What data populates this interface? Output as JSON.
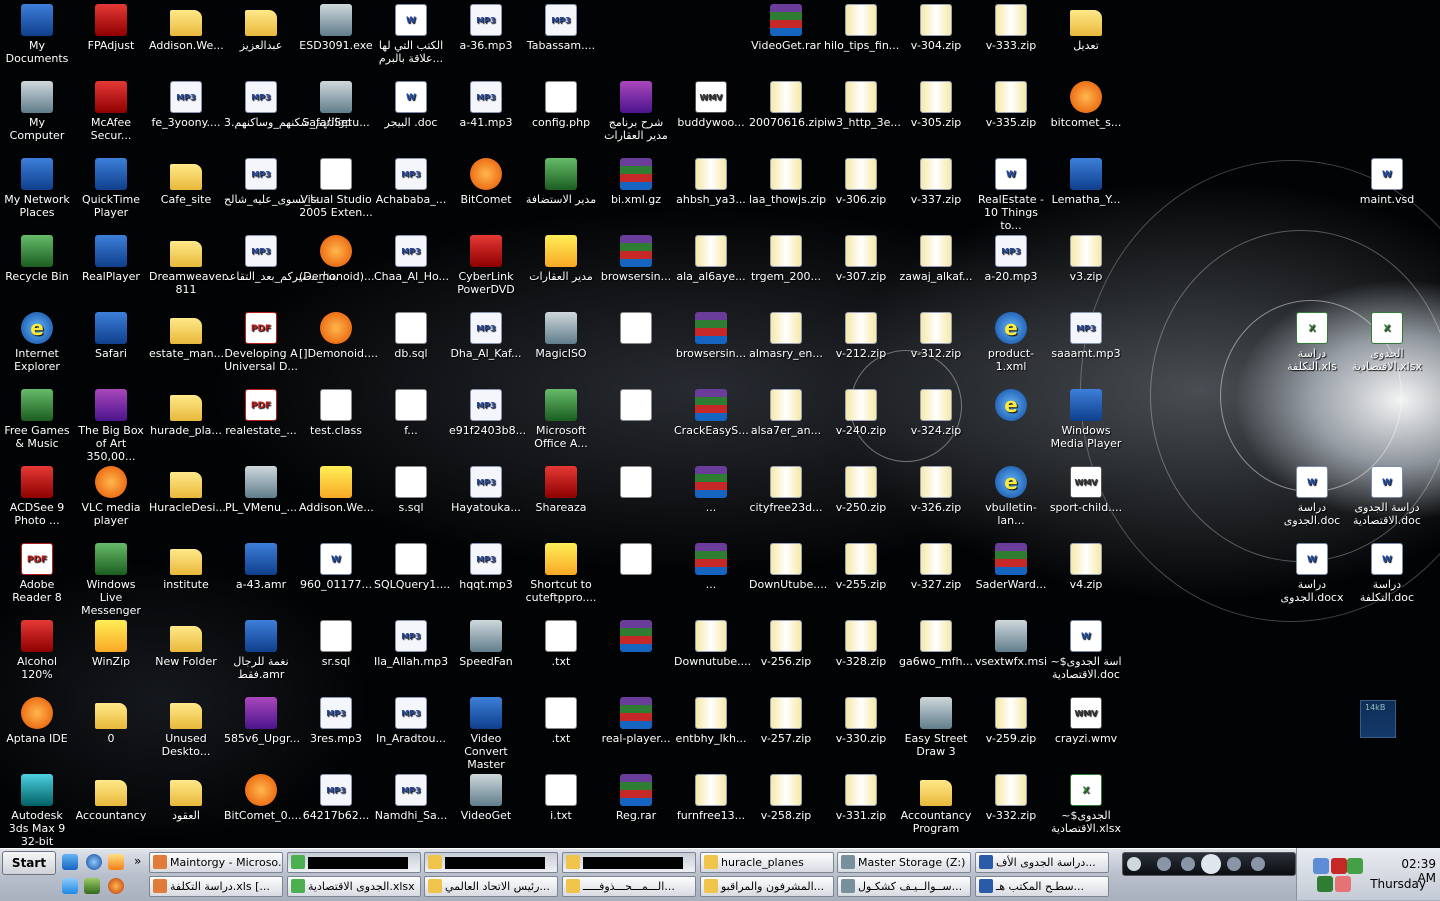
{
  "desktop_icons": [
    {
      "label": "My Documents",
      "kind": "app"
    },
    {
      "label": "FPAdjust",
      "kind": "red"
    },
    {
      "label": "Addison.We...",
      "kind": "folder"
    },
    {
      "label": "عبدالعزيز",
      "kind": "folder"
    },
    {
      "label": "ESD3091.exe",
      "kind": "sys"
    },
    {
      "label": "الكتب التي لها علاقة بالبرم...",
      "kind": "doc"
    },
    {
      "label": "a-36.mp3",
      "kind": "mp3"
    },
    {
      "label": "Tabassam....",
      "kind": "mp3"
    },
    {
      "label": "VideoGet.rar",
      "kind": "rar"
    },
    {
      "label": "hilo_tips_fin...",
      "kind": "zip"
    },
    {
      "label": "v-304.zip",
      "kind": "zip"
    },
    {
      "label": "v-333.zip",
      "kind": "zip"
    },
    {
      "label": "تعديل",
      "kind": "folder"
    },
    {
      "label": "My Computer",
      "kind": "sys"
    },
    {
      "label": "McAfee Secur...",
      "kind": "red"
    },
    {
      "label": "fe_3yoony....",
      "kind": "mp3"
    },
    {
      "label": "اللهم_سكنهم_وساكنهم.3gp",
      "kind": "mp3"
    },
    {
      "label": "SafariSetu...",
      "kind": "sys"
    },
    {
      "label": "البيجر .doc",
      "kind": "doc"
    },
    {
      "label": "a-41.mp3",
      "kind": "mp3"
    },
    {
      "label": "config.php",
      "kind": "txt"
    },
    {
      "label": "شرح برنامج مدير العقارات",
      "kind": "purple"
    },
    {
      "label": "buddywoo...",
      "kind": "wmv"
    },
    {
      "label": "20070616.zip",
      "kind": "zip"
    },
    {
      "label": "iw3_http_3e...",
      "kind": "zip"
    },
    {
      "label": "v-305.zip",
      "kind": "zip"
    },
    {
      "label": "v-335.zip",
      "kind": "zip"
    },
    {
      "label": "bitcomet_s...",
      "kind": "orange"
    },
    {
      "label": "My Network Places",
      "kind": "app"
    },
    {
      "label": "QuickTime Player",
      "kind": "app"
    },
    {
      "label": "Cafe_site",
      "kind": "folder"
    },
    {
      "label": "ما_تسوى_عليه_شالح",
      "kind": "mp3"
    },
    {
      "label": "Visual Studio 2005 Exten...",
      "kind": "txt"
    },
    {
      "label": "Achababa_...",
      "kind": "mp3"
    },
    {
      "label": "BitComet",
      "kind": "orange"
    },
    {
      "label": "مدير الاستضافة",
      "kind": "green"
    },
    {
      "label": "bi.xml.gz",
      "kind": "rar"
    },
    {
      "label": "ahbsh_ya3...",
      "kind": "zip"
    },
    {
      "label": "laa_thowjs.zip",
      "kind": "zip"
    },
    {
      "label": "v-306.zip",
      "kind": "zip"
    },
    {
      "label": "v-337.zip",
      "kind": "zip"
    },
    {
      "label": "RealEstate - 10 Things to...",
      "kind": "doc"
    },
    {
      "label": "Lematha_Y...",
      "kind": "app"
    },
    {
      "label": "Recycle Bin",
      "kind": "green"
    },
    {
      "label": "RealPlayer",
      "kind": "app"
    },
    {
      "label": "Dreamweaver 811",
      "kind": "folder"
    },
    {
      "label": "هذا_مصيركم_بعد_التقاعد",
      "kind": "mp3"
    },
    {
      "label": "(Demonoid)...",
      "kind": "orange"
    },
    {
      "label": "Chaa_Al_Ho...",
      "kind": "mp3"
    },
    {
      "label": "CyberLink PowerDVD",
      "kind": "red"
    },
    {
      "label": "مدير العقارات",
      "kind": "yellow"
    },
    {
      "label": "browsersin...",
      "kind": "rar"
    },
    {
      "label": "ala_al6aye...",
      "kind": "zip"
    },
    {
      "label": "trgem_200...",
      "kind": "zip"
    },
    {
      "label": "v-307.zip",
      "kind": "zip"
    },
    {
      "label": "zawaj_alkaf...",
      "kind": "zip"
    },
    {
      "label": "a-20.mp3",
      "kind": "mp3"
    },
    {
      "label": "v3.zip",
      "kind": "zip"
    },
    {
      "label": "Internet Explorer",
      "kind": "ie"
    },
    {
      "label": "Safari",
      "kind": "app"
    },
    {
      "label": "estate_man...",
      "kind": "folder"
    },
    {
      "label": "Developing A Universal D...",
      "kind": "pdf"
    },
    {
      "label": "[]Demonoid....",
      "kind": "orange"
    },
    {
      "label": "db.sql",
      "kind": "txt"
    },
    {
      "label": "Dha_Al_Kaf...",
      "kind": "mp3"
    },
    {
      "label": "MagicISO",
      "kind": "sys"
    },
    {
      "label": "",
      "kind": "txt"
    },
    {
      "label": "browsersin...",
      "kind": "rar"
    },
    {
      "label": "almasry_en...",
      "kind": "zip"
    },
    {
      "label": "v-212.zip",
      "kind": "zip"
    },
    {
      "label": "v-312.zip",
      "kind": "zip"
    },
    {
      "label": "product-1.xml",
      "kind": "ie"
    },
    {
      "label": "saaamt.mp3",
      "kind": "mp3"
    },
    {
      "label": "Free Games & Music",
      "kind": "green"
    },
    {
      "label": "The Big Box of Art 350,00...",
      "kind": "purple"
    },
    {
      "label": "hurade_pla...",
      "kind": "folder"
    },
    {
      "label": "realestate_...",
      "kind": "pdf"
    },
    {
      "label": "test.class",
      "kind": "txt"
    },
    {
      "label": "f...",
      "kind": "txt"
    },
    {
      "label": "e91f2403b8...",
      "kind": "mp3"
    },
    {
      "label": "Microsoft Office A...",
      "kind": "green"
    },
    {
      "label": "",
      "kind": "txt"
    },
    {
      "label": "CrackEasyS...",
      "kind": "rar"
    },
    {
      "label": "alsa7er_an...",
      "kind": "zip"
    },
    {
      "label": "v-240.zip",
      "kind": "zip"
    },
    {
      "label": "v-324.zip",
      "kind": "zip"
    },
    {
      "label": "",
      "kind": "ie"
    },
    {
      "label": "Windows Media Player",
      "kind": "app"
    },
    {
      "label": "ACDSee 9 Photo ...",
      "kind": "red"
    },
    {
      "label": "VLC media player",
      "kind": "orange"
    },
    {
      "label": "HuracleDesi...",
      "kind": "folder"
    },
    {
      "label": "PL_VMenu_...",
      "kind": "sys"
    },
    {
      "label": "Addison.We...",
      "kind": "yellow"
    },
    {
      "label": "s.sql",
      "kind": "txt"
    },
    {
      "label": "Hayatouka...",
      "kind": "mp3"
    },
    {
      "label": "Shareaza",
      "kind": "red"
    },
    {
      "label": "",
      "kind": "txt"
    },
    {
      "label": "...",
      "kind": "rar"
    },
    {
      "label": "cityfree23d...",
      "kind": "zip"
    },
    {
      "label": "v-250.zip",
      "kind": "zip"
    },
    {
      "label": "v-326.zip",
      "kind": "zip"
    },
    {
      "label": "vbulletin-lan...",
      "kind": "ie"
    },
    {
      "label": "sport-child....",
      "kind": "wmv"
    },
    {
      "label": "Adobe Reader 8",
      "kind": "pdf"
    },
    {
      "label": "Windows Live Messenger",
      "kind": "green"
    },
    {
      "label": "institute",
      "kind": "folder"
    },
    {
      "label": "a-43.amr",
      "kind": "app"
    },
    {
      "label": "960_01177...",
      "kind": "doc"
    },
    {
      "label": "SQLQuery1....",
      "kind": "txt"
    },
    {
      "label": "hqqt.mp3",
      "kind": "mp3"
    },
    {
      "label": "Shortcut to cuteftppro....",
      "kind": "yellow"
    },
    {
      "label": "",
      "kind": "txt"
    },
    {
      "label": "...",
      "kind": "rar"
    },
    {
      "label": "DownUtube....",
      "kind": "zip"
    },
    {
      "label": "v-255.zip",
      "kind": "zip"
    },
    {
      "label": "v-327.zip",
      "kind": "zip"
    },
    {
      "label": "SaderWard...",
      "kind": "rar"
    },
    {
      "label": "v4.zip",
      "kind": "zip"
    },
    {
      "label": "Alcohol 120%",
      "kind": "red"
    },
    {
      "label": "WinZip",
      "kind": "yellow"
    },
    {
      "label": "New Folder",
      "kind": "folder"
    },
    {
      "label": "نغمة للرجال فقط.amr",
      "kind": "app"
    },
    {
      "label": "sr.sql",
      "kind": "txt"
    },
    {
      "label": "Ila_Allah.mp3",
      "kind": "mp3"
    },
    {
      "label": "SpeedFan",
      "kind": "sys"
    },
    {
      "label": ".txt",
      "kind": "txt"
    },
    {
      "label": "",
      "kind": "rar"
    },
    {
      "label": "Downutube....",
      "kind": "zip"
    },
    {
      "label": "v-256.zip",
      "kind": "zip"
    },
    {
      "label": "v-328.zip",
      "kind": "zip"
    },
    {
      "label": "ga6wo_mfh...",
      "kind": "zip"
    },
    {
      "label": "vsextwfx.msi",
      "kind": "sys"
    },
    {
      "label": "اسة الجدوى$~ الاقتصادية.doc",
      "kind": "doc"
    },
    {
      "label": "Aptana IDE",
      "kind": "orange"
    },
    {
      "label": "0",
      "kind": "folder"
    },
    {
      "label": "Unused Deskto...",
      "kind": "folder"
    },
    {
      "label": "585v6_Upgr...",
      "kind": "purple"
    },
    {
      "label": "3res.mp3",
      "kind": "mp3"
    },
    {
      "label": "In_Aradtou...",
      "kind": "mp3"
    },
    {
      "label": "Video Convert Master",
      "kind": "app"
    },
    {
      "label": ".txt",
      "kind": "txt"
    },
    {
      "label": "real-player...",
      "kind": "rar"
    },
    {
      "label": "entbhy_lkh...",
      "kind": "zip"
    },
    {
      "label": "v-257.zip",
      "kind": "zip"
    },
    {
      "label": "v-330.zip",
      "kind": "zip"
    },
    {
      "label": "Easy Street Draw 3",
      "kind": "sys"
    },
    {
      "label": "v-259.zip",
      "kind": "zip"
    },
    {
      "label": "crayzi.wmv",
      "kind": "wmv"
    },
    {
      "label": "Autodesk 3ds Max 9 32-bit",
      "kind": "cyan"
    },
    {
      "label": "Accountancy",
      "kind": "folder"
    },
    {
      "label": "العقود",
      "kind": "folder"
    },
    {
      "label": "BitComet_0....",
      "kind": "orange"
    },
    {
      "label": "64217b62...",
      "kind": "mp3"
    },
    {
      "label": "Namdhi_Sa...",
      "kind": "mp3"
    },
    {
      "label": "VideoGet",
      "kind": "sys"
    },
    {
      "label": "i.txt",
      "kind": "txt"
    },
    {
      "label": "Reg.rar",
      "kind": "rar"
    },
    {
      "label": "furnfree13...",
      "kind": "zip"
    },
    {
      "label": "v-258.zip",
      "kind": "zip"
    },
    {
      "label": "v-331.zip",
      "kind": "zip"
    },
    {
      "label": "Accountancy Program",
      "kind": "folder"
    },
    {
      "label": "v-332.zip",
      "kind": "zip"
    },
    {
      "label": "الجدوى$~ الاقتصادية.xlsx",
      "kind": "xls"
    },
    {
      "label": "maint.vsd",
      "kind": "doc"
    },
    {
      "label": "دراسة التكلفة.xls",
      "kind": "xls"
    },
    {
      "label": "الجدوى الاقتصادية.xlsx",
      "kind": "xls"
    },
    {
      "label": "دراسة الجدوى.doc",
      "kind": "doc"
    },
    {
      "label": "دراسة الجدوى الاقتصادية.doc",
      "kind": "doc"
    },
    {
      "label": "دراسة الجدوى.docx",
      "kind": "doc"
    },
    {
      "label": "دراسة التكلفة.doc",
      "kind": "doc"
    }
  ],
  "net_meter": "14kB",
  "taskbar": {
    "start_label": "Start",
    "row1": [
      "Maintorgy - Microso...",
      "",
      "",
      "",
      "huracle_planes",
      "Master Storage (Z:)",
      "دراسة الجدوى الأف..."
    ],
    "row2": [
      "دراسة التكلفة.xls  [...",
      "الجدوى الاقتصادية.xlsx",
      "رئيس الاتحاد العالمي...",
      "الـــمـــحـــذوفـــــ...",
      "المشرفون والمراقبو...",
      "ســوالــيـف كشكـول...",
      "سطـح المكتب هـ..."
    ]
  },
  "clock": {
    "time": "02:39 AM",
    "day": "Thursday"
  }
}
